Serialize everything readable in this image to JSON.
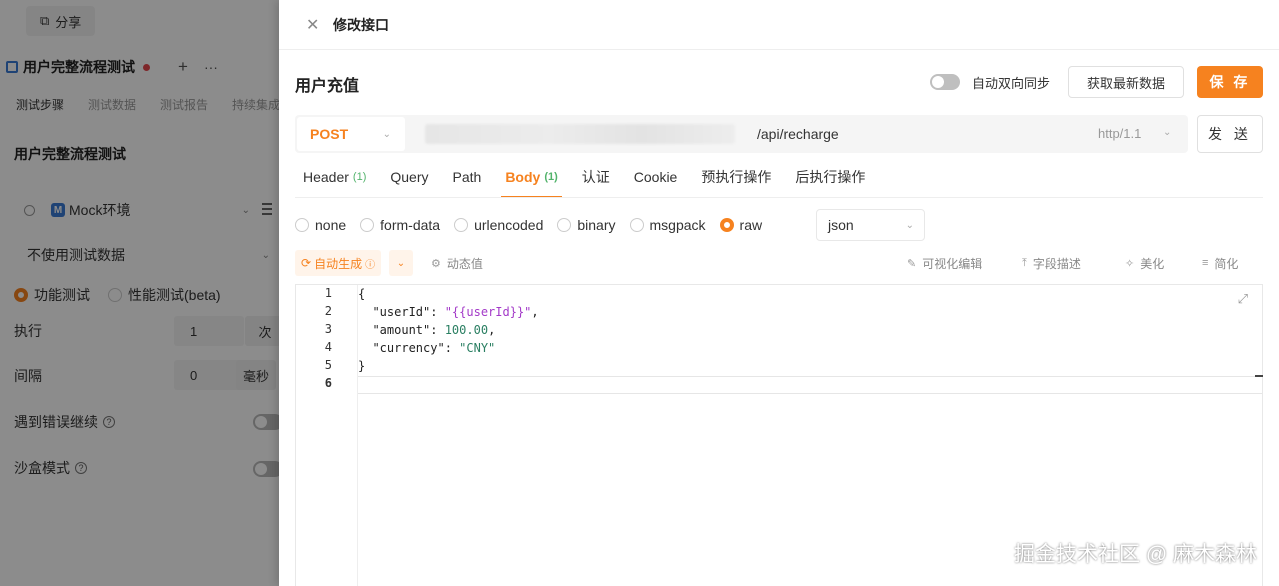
{
  "left": {
    "share_label": "分享",
    "tab_title": "用户完整流程测试",
    "tab_plus": "+",
    "tab_more": "···",
    "subtabs": [
      "测试步骤",
      "测试数据",
      "测试报告",
      "持续集成"
    ],
    "heading": "用户完整流程测试",
    "env_badge": "M",
    "env_name": "Mock环境",
    "data_select": "不使用测试数据",
    "mode_functional": "功能测试",
    "mode_performance": "性能测试(beta)",
    "exec_label": "执行",
    "exec_value": "1",
    "exec_unit": "次",
    "interval_label": "间隔",
    "interval_value": "0",
    "interval_unit": "毫秒",
    "continue_on_error": "遇到错误继续",
    "sandbox_mode": "沙盒模式"
  },
  "drawer": {
    "title": "修改接口",
    "api_name": "用户充值",
    "sync_label": "自动双向同步",
    "fetch_button": "获取最新数据",
    "save_button": "保 存",
    "method": "POST",
    "path": "/api/recharge",
    "protocol": "http/1.1",
    "send_button": "发 送",
    "tabs": [
      {
        "label": "Header",
        "count": "(1)"
      },
      {
        "label": "Query",
        "count": ""
      },
      {
        "label": "Path",
        "count": ""
      },
      {
        "label": "Body",
        "count": "(1)"
      },
      {
        "label": "认证",
        "count": ""
      },
      {
        "label": "Cookie",
        "count": ""
      },
      {
        "label": "预执行操作",
        "count": ""
      },
      {
        "label": "后执行操作",
        "count": ""
      }
    ],
    "active_tab": "Body",
    "body_types": [
      "none",
      "form-data",
      "urlencoded",
      "binary",
      "msgpack",
      "raw"
    ],
    "selected_body_type": "raw",
    "format": "json",
    "autogen_label": "自动生成",
    "dynamic_value": "动态值",
    "visual_edit": "可视化编辑",
    "field_desc": "字段描述",
    "beautify": "美化",
    "simplify": "简化",
    "line_numbers": [
      "1",
      "2",
      "3",
      "4",
      "5",
      "6"
    ],
    "code": {
      "l1": "{",
      "l2_key": "\"userId\"",
      "l2_val": "\"{{userId}}\"",
      "l3_key": "\"amount\"",
      "l3_val": "100.00",
      "l4_key": "\"currency\"",
      "l4_val": "\"CNY\"",
      "l5": "}"
    }
  },
  "watermark": "掘金技术社区 @ 麻木森林",
  "colors": {
    "accent": "#f6821f",
    "count_green": "#52b36b"
  }
}
